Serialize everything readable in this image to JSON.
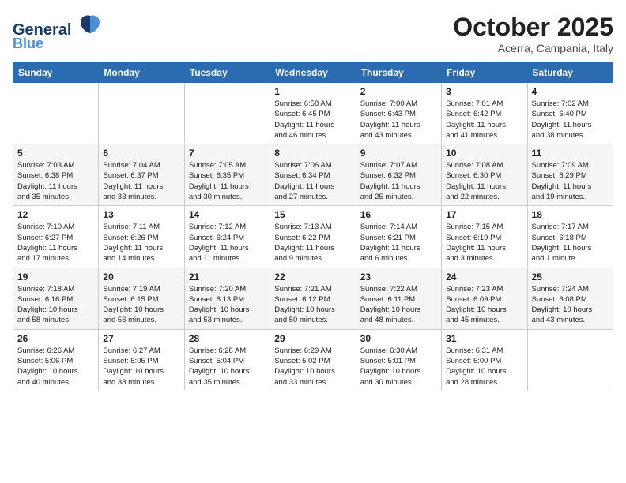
{
  "header": {
    "logo_line1": "General",
    "logo_line2": "Blue",
    "month": "October 2025",
    "location": "Acerra, Campania, Italy"
  },
  "days_of_week": [
    "Sunday",
    "Monday",
    "Tuesday",
    "Wednesday",
    "Thursday",
    "Friday",
    "Saturday"
  ],
  "weeks": [
    [
      {
        "num": "",
        "info": ""
      },
      {
        "num": "",
        "info": ""
      },
      {
        "num": "",
        "info": ""
      },
      {
        "num": "1",
        "info": "Sunrise: 6:58 AM\nSunset: 6:45 PM\nDaylight: 11 hours\nand 46 minutes."
      },
      {
        "num": "2",
        "info": "Sunrise: 7:00 AM\nSunset: 6:43 PM\nDaylight: 11 hours\nand 43 minutes."
      },
      {
        "num": "3",
        "info": "Sunrise: 7:01 AM\nSunset: 6:42 PM\nDaylight: 11 hours\nand 41 minutes."
      },
      {
        "num": "4",
        "info": "Sunrise: 7:02 AM\nSunset: 6:40 PM\nDaylight: 11 hours\nand 38 minutes."
      }
    ],
    [
      {
        "num": "5",
        "info": "Sunrise: 7:03 AM\nSunset: 6:38 PM\nDaylight: 11 hours\nand 35 minutes."
      },
      {
        "num": "6",
        "info": "Sunrise: 7:04 AM\nSunset: 6:37 PM\nDaylight: 11 hours\nand 33 minutes."
      },
      {
        "num": "7",
        "info": "Sunrise: 7:05 AM\nSunset: 6:35 PM\nDaylight: 11 hours\nand 30 minutes."
      },
      {
        "num": "8",
        "info": "Sunrise: 7:06 AM\nSunset: 6:34 PM\nDaylight: 11 hours\nand 27 minutes."
      },
      {
        "num": "9",
        "info": "Sunrise: 7:07 AM\nSunset: 6:32 PM\nDaylight: 11 hours\nand 25 minutes."
      },
      {
        "num": "10",
        "info": "Sunrise: 7:08 AM\nSunset: 6:30 PM\nDaylight: 11 hours\nand 22 minutes."
      },
      {
        "num": "11",
        "info": "Sunrise: 7:09 AM\nSunset: 6:29 PM\nDaylight: 11 hours\nand 19 minutes."
      }
    ],
    [
      {
        "num": "12",
        "info": "Sunrise: 7:10 AM\nSunset: 6:27 PM\nDaylight: 11 hours\nand 17 minutes."
      },
      {
        "num": "13",
        "info": "Sunrise: 7:11 AM\nSunset: 6:26 PM\nDaylight: 11 hours\nand 14 minutes."
      },
      {
        "num": "14",
        "info": "Sunrise: 7:12 AM\nSunset: 6:24 PM\nDaylight: 11 hours\nand 11 minutes."
      },
      {
        "num": "15",
        "info": "Sunrise: 7:13 AM\nSunset: 6:22 PM\nDaylight: 11 hours\nand 9 minutes."
      },
      {
        "num": "16",
        "info": "Sunrise: 7:14 AM\nSunset: 6:21 PM\nDaylight: 11 hours\nand 6 minutes."
      },
      {
        "num": "17",
        "info": "Sunrise: 7:15 AM\nSunset: 6:19 PM\nDaylight: 11 hours\nand 3 minutes."
      },
      {
        "num": "18",
        "info": "Sunrise: 7:17 AM\nSunset: 6:18 PM\nDaylight: 11 hours\nand 1 minute."
      }
    ],
    [
      {
        "num": "19",
        "info": "Sunrise: 7:18 AM\nSunset: 6:16 PM\nDaylight: 10 hours\nand 58 minutes."
      },
      {
        "num": "20",
        "info": "Sunrise: 7:19 AM\nSunset: 6:15 PM\nDaylight: 10 hours\nand 56 minutes."
      },
      {
        "num": "21",
        "info": "Sunrise: 7:20 AM\nSunset: 6:13 PM\nDaylight: 10 hours\nand 53 minutes."
      },
      {
        "num": "22",
        "info": "Sunrise: 7:21 AM\nSunset: 6:12 PM\nDaylight: 10 hours\nand 50 minutes."
      },
      {
        "num": "23",
        "info": "Sunrise: 7:22 AM\nSunset: 6:11 PM\nDaylight: 10 hours\nand 48 minutes."
      },
      {
        "num": "24",
        "info": "Sunrise: 7:23 AM\nSunset: 6:09 PM\nDaylight: 10 hours\nand 45 minutes."
      },
      {
        "num": "25",
        "info": "Sunrise: 7:24 AM\nSunset: 6:08 PM\nDaylight: 10 hours\nand 43 minutes."
      }
    ],
    [
      {
        "num": "26",
        "info": "Sunrise: 6:26 AM\nSunset: 5:06 PM\nDaylight: 10 hours\nand 40 minutes."
      },
      {
        "num": "27",
        "info": "Sunrise: 6:27 AM\nSunset: 5:05 PM\nDaylight: 10 hours\nand 38 minutes."
      },
      {
        "num": "28",
        "info": "Sunrise: 6:28 AM\nSunset: 5:04 PM\nDaylight: 10 hours\nand 35 minutes."
      },
      {
        "num": "29",
        "info": "Sunrise: 6:29 AM\nSunset: 5:02 PM\nDaylight: 10 hours\nand 33 minutes."
      },
      {
        "num": "30",
        "info": "Sunrise: 6:30 AM\nSunset: 5:01 PM\nDaylight: 10 hours\nand 30 minutes."
      },
      {
        "num": "31",
        "info": "Sunrise: 6:31 AM\nSunset: 5:00 PM\nDaylight: 10 hours\nand 28 minutes."
      },
      {
        "num": "",
        "info": ""
      }
    ]
  ]
}
